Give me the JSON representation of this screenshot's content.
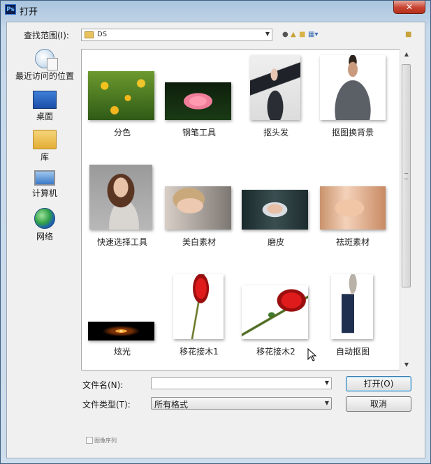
{
  "window": {
    "title": "打开",
    "app_icon": "Ps",
    "close_glyph": "✕"
  },
  "lookin": {
    "label": "查找范围(I):",
    "value": "DS"
  },
  "places": [
    {
      "label": "最近访问的位置",
      "icon": "recent-places-icon"
    },
    {
      "label": "桌面",
      "icon": "desktop-icon"
    },
    {
      "label": "库",
      "icon": "library-icon"
    },
    {
      "label": "计算机",
      "icon": "computer-icon"
    },
    {
      "label": "网络",
      "icon": "network-icon"
    }
  ],
  "files": [
    {
      "name": "分色"
    },
    {
      "name": "钢笔工具"
    },
    {
      "name": "抠头发"
    },
    {
      "name": "抠图换背景"
    },
    {
      "name": "快速选择工具"
    },
    {
      "name": "美白素材"
    },
    {
      "name": "磨皮"
    },
    {
      "name": "祛斑素材"
    },
    {
      "name": "炫光"
    },
    {
      "name": "移花接木1"
    },
    {
      "name": "移花接木2"
    },
    {
      "name": "自动抠图"
    }
  ],
  "filename": {
    "label": "文件名(N):",
    "value": ""
  },
  "filetype": {
    "label": "文件类型(T):",
    "value": "所有格式"
  },
  "buttons": {
    "open": "打开(O)",
    "cancel": "取消"
  },
  "image_sequence": {
    "label": "图像序列",
    "checked": false
  }
}
